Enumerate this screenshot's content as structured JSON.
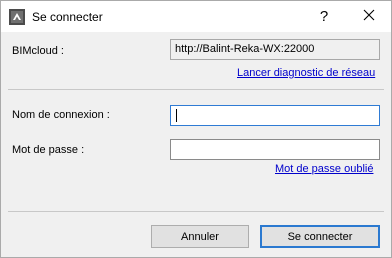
{
  "window": {
    "title": "Se connecter",
    "help_glyph": "?"
  },
  "server": {
    "label": "BIMcloud :",
    "url": "http://Balint-Reka-WX:22000",
    "diagnostic_link": "Lancer diagnostic de réseau"
  },
  "login": {
    "username_label": "Nom de connexion :",
    "username_value": "",
    "password_label": "Mot de passe :",
    "password_value": "",
    "forgot_link": "Mot de passe oublié"
  },
  "buttons": {
    "cancel": "Annuler",
    "connect": "Se connecter"
  },
  "colors": {
    "link": "#0000cc",
    "focus_border": "#2f7bd4",
    "dialog_bg": "#f0f0f0"
  },
  "icons": {
    "app": "archicad-bimcloud-icon",
    "close": "close-icon"
  }
}
